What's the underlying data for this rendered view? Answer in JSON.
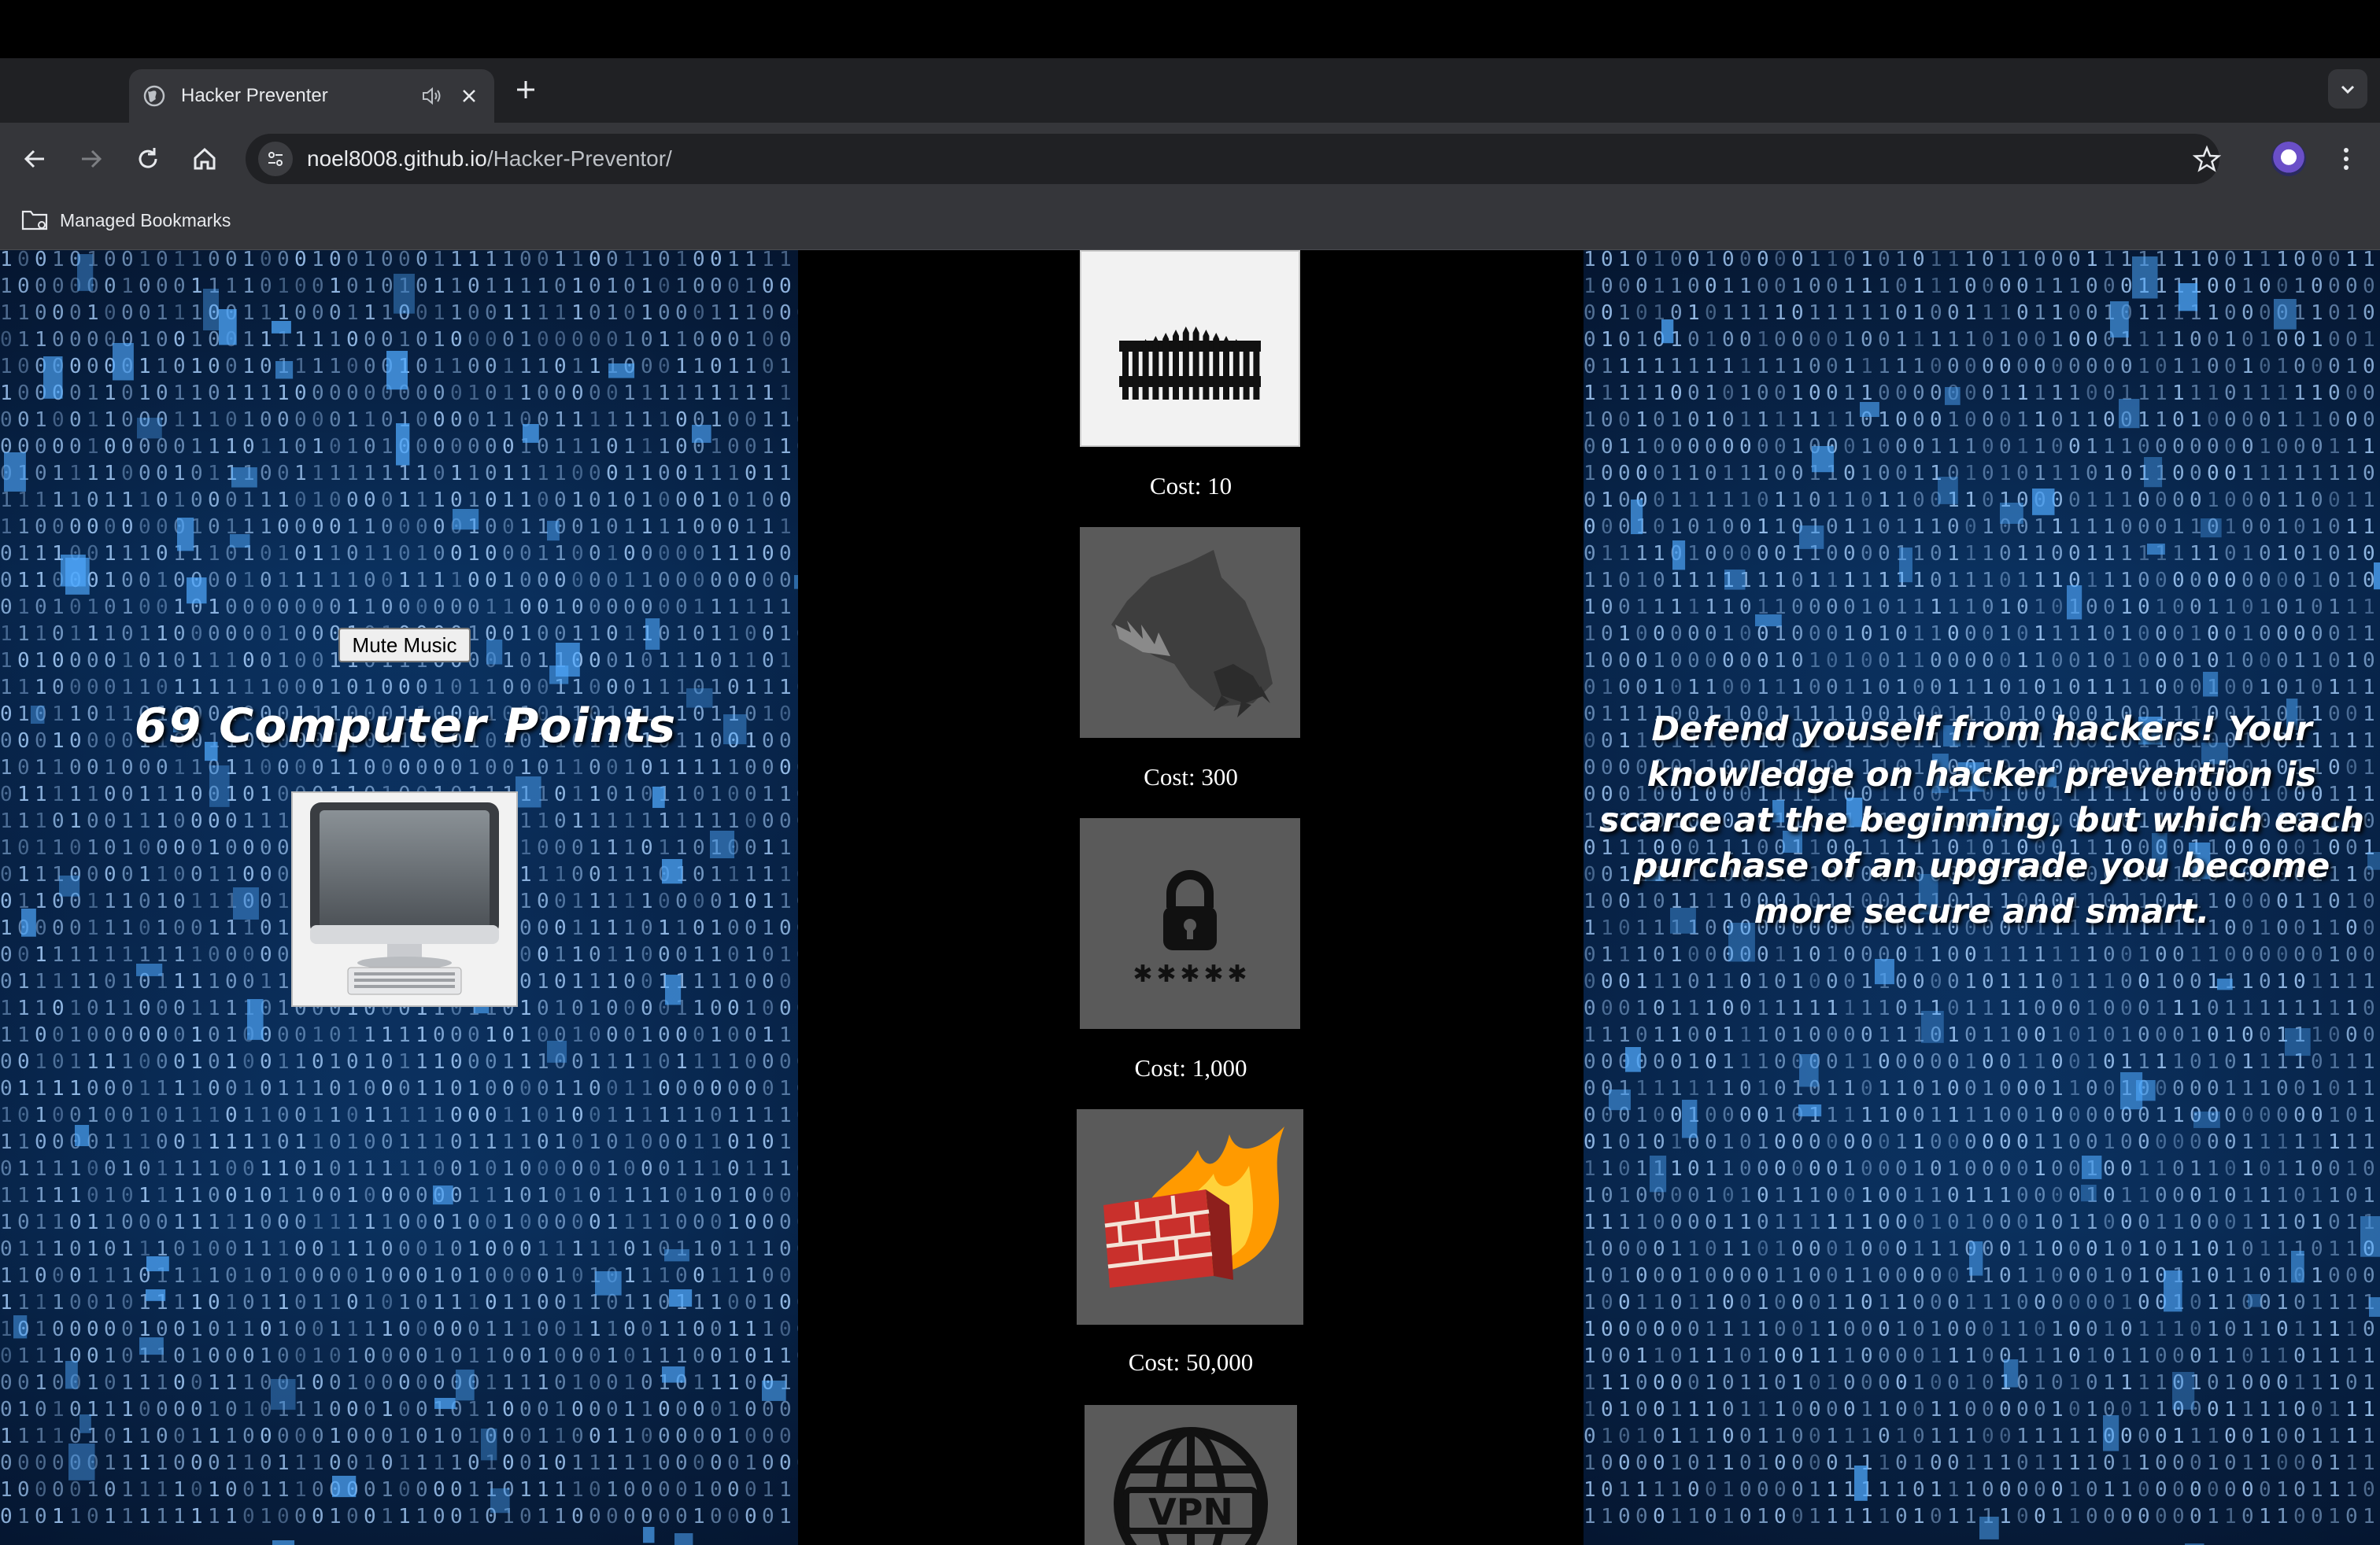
{
  "browser": {
    "tab_title": "Hacker Preventer",
    "url_host": "noel8008.github.io",
    "url_path": "/Hacker-Preventor/",
    "bookmarks_label": "Managed Bookmarks"
  },
  "game": {
    "mute_label": "Mute Music",
    "points_text": "69 Computer Points",
    "tagline": "Defend youself from hackers! Your knowledge on hacker prevention is scarce at the beginning, but which each purchase of an upgrade you become more secure and smart.",
    "upgrades": [
      {
        "icon": "fence-icon",
        "cost": "Cost: 10"
      },
      {
        "icon": "guard-dog-icon",
        "cost": "Cost: 300"
      },
      {
        "icon": "password-lock-icon",
        "cost": "Cost: 1,000"
      },
      {
        "icon": "firewall-icon",
        "cost": "Cost: 50,000"
      },
      {
        "icon": "vpn-icon",
        "cost": ""
      }
    ],
    "vpn_text": "VPN"
  },
  "colors": {
    "matrix_blue": "#0d3a6e",
    "digit_blue": "#6fb6ff",
    "upgrade_locked_bg": "#5a5a5a",
    "upgrade_unlocked_bg": "#f2f2f2"
  }
}
